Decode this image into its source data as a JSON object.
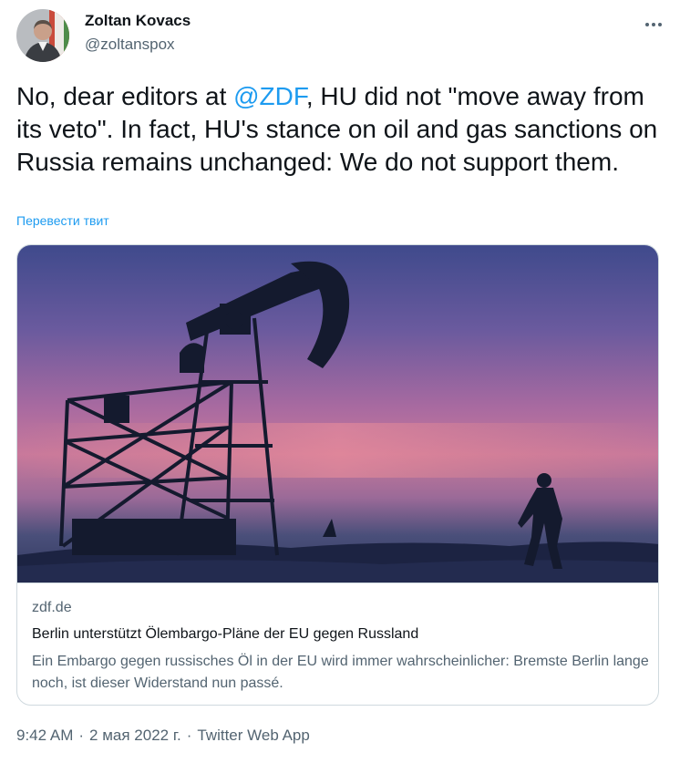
{
  "author": {
    "name": "Zoltan Kovacs",
    "handle": "@zoltanspox"
  },
  "tweet": {
    "text_before_mention": "No, dear editors at ",
    "mention": "@ZDF",
    "text_after_mention": ", HU did not \"move away from its veto\". In fact, HU's stance on oil and gas sanctions on Russia remains unchanged: We do not support them.",
    "translate_label": "Перевести твит"
  },
  "card": {
    "domain": "zdf.de",
    "title": "Berlin unterstützt Ölembargo-Pläne der EU gegen Russland",
    "description": "Ein Embargo gegen russisches Öl in der EU wird immer wahrscheinlicher: Bremste Berlin lange noch, ist dieser Widerstand nun passé."
  },
  "meta": {
    "time": "9:42 AM",
    "separator": "·",
    "date": "2 мая 2022 г.",
    "source": "Twitter Web App"
  },
  "icons": {
    "more": "more-horizontal-icon"
  },
  "colors": {
    "accent": "#1d9bf0",
    "secondary_text": "#536471",
    "border": "#cfd9de"
  }
}
